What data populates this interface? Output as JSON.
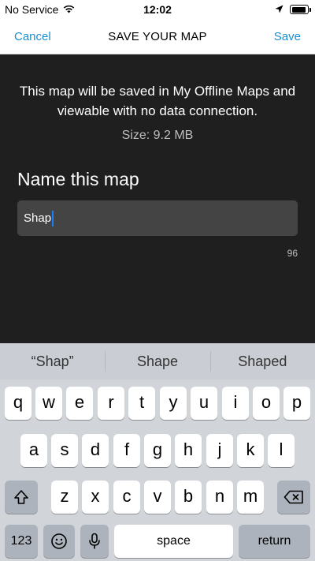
{
  "status_bar": {
    "carrier": "No Service",
    "time": "12:02",
    "wifi_icon": "wifi-icon",
    "location_icon": "location-arrow-icon",
    "battery_icon": "battery-icon"
  },
  "nav": {
    "cancel_label": "Cancel",
    "title": "SAVE YOUR MAP",
    "save_label": "Save"
  },
  "main": {
    "info_text": "This map will be saved in My Offline Maps and viewable with no data connection.",
    "size_text": "Size: 9.2 MB",
    "name_heading": "Name this map",
    "name_value": "Shap",
    "char_count": "96"
  },
  "keyboard": {
    "suggestions": [
      "“Shap”",
      "Shape",
      "Shaped"
    ],
    "row1": [
      "q",
      "w",
      "e",
      "r",
      "t",
      "y",
      "u",
      "i",
      "o",
      "p"
    ],
    "row2": [
      "a",
      "s",
      "d",
      "f",
      "g",
      "h",
      "j",
      "k",
      "l"
    ],
    "row3": [
      "z",
      "x",
      "c",
      "v",
      "b",
      "n",
      "m"
    ],
    "numbers_label": "123",
    "space_label": "space",
    "return_label": "return",
    "shift_icon": "shift-icon",
    "delete_icon": "delete-icon",
    "emoji_icon": "emoji-icon",
    "mic_icon": "microphone-icon"
  }
}
